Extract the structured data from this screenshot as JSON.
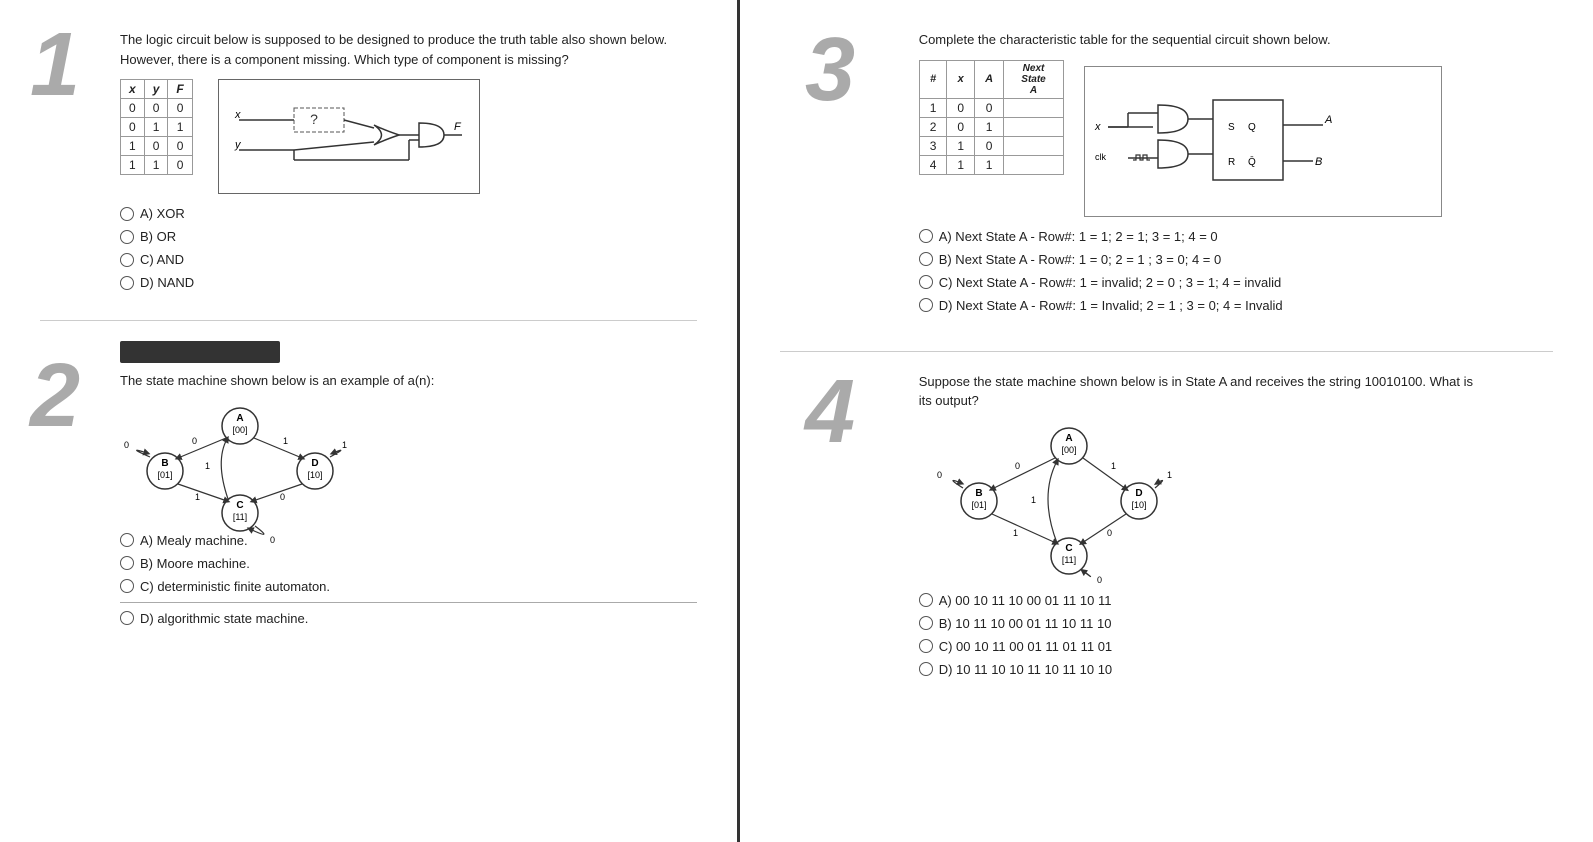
{
  "q1": {
    "number": "1",
    "text": "The logic circuit below is supposed to be designed to produce the truth table also shown below. However, there is a component missing. Which type of component is missing?",
    "truth_table": {
      "headers": [
        "x",
        "y",
        "F"
      ],
      "rows": [
        [
          "0",
          "0",
          "0"
        ],
        [
          "0",
          "1",
          "1"
        ],
        [
          "1",
          "0",
          "0"
        ],
        [
          "1",
          "1",
          "0"
        ]
      ]
    },
    "options": [
      {
        "label": "A) XOR"
      },
      {
        "label": "B) OR"
      },
      {
        "label": "C) AND"
      },
      {
        "label": "D) NAND"
      }
    ]
  },
  "q2": {
    "number": "2",
    "text": "The state machine shown below is an example of a(n):",
    "options": [
      {
        "label": "A) Mealy machine."
      },
      {
        "label": "B) Moore machine."
      },
      {
        "label": "C) deterministic finite automaton."
      },
      {
        "label": "D) algorithmic state machine."
      }
    ]
  },
  "q3": {
    "number": "3",
    "text": "Complete the characteristic table for the sequential circuit shown below.",
    "char_table": {
      "headers": [
        "#",
        "x",
        "A",
        "Next State A"
      ],
      "rows": [
        [
          "1",
          "0",
          "0",
          ""
        ],
        [
          "2",
          "0",
          "1",
          ""
        ],
        [
          "3",
          "1",
          "0",
          ""
        ],
        [
          "4",
          "1",
          "1",
          ""
        ]
      ]
    },
    "options": [
      {
        "label": "A) Next State A - Row#: 1 = 1; 2 = 1; 3 = 1; 4 = 0"
      },
      {
        "label": "B) Next State A - Row#: 1 = 0; 2 = 1 ; 3 = 0; 4 = 0"
      },
      {
        "label": "C) Next State A - Row#: 1 = invalid; 2 = 0 ; 3 = 1; 4 = invalid"
      },
      {
        "label": "D) Next State A - Row#: 1 = Invalid; 2 = 1 ; 3 = 0; 4 = Invalid"
      }
    ]
  },
  "q4": {
    "number": "4",
    "text": "Suppose the state machine shown below is in State A and receives the string 10010100. What is its output?",
    "options": [
      {
        "label": "A) 00 10 11 10 00 01 11 10 11"
      },
      {
        "label": "B) 10 11 10 00 01 11 10 11 10"
      },
      {
        "label": "C) 00 10 11 00 01 11 01 11 01"
      },
      {
        "label": "D) 10 11 10 10 11 10 11 10 10"
      }
    ]
  }
}
